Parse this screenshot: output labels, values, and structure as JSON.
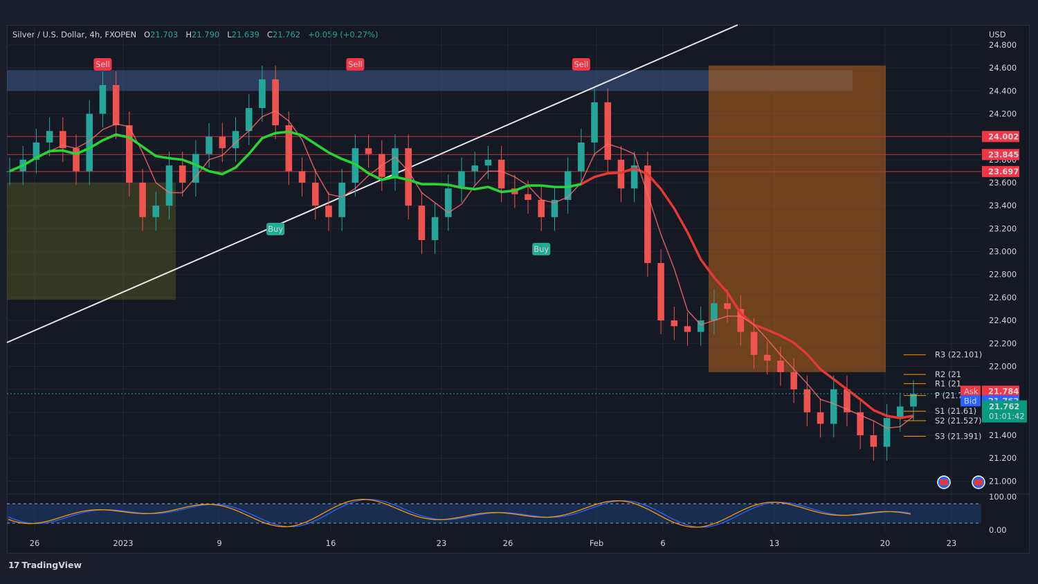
{
  "header": {
    "symbol": "Silver / U.S. Dollar, 4h, FXOPEN",
    "o_label": "O",
    "o": "21.703",
    "h_label": "H",
    "h": "21.790",
    "l_label": "L",
    "l": "21.639",
    "c_label": "C",
    "c": "21.762",
    "change": "+0.059 (+0.27%)"
  },
  "currency": "USD",
  "footer": {
    "brand": "TradingView"
  },
  "colors": {
    "up": "#26a69a",
    "down": "#ef5350",
    "sell_signal": "#f23645",
    "buy_signal": "#22ab94",
    "pivot": "#ff9800",
    "ask": "#f23645",
    "bid": "#2962ff"
  },
  "chart_data": {
    "type": "line",
    "title": "Silver / U.S. Dollar, 4h, FXOPEN",
    "ylim": [
      20.9,
      24.95
    ],
    "y_ticks": [
      24.8,
      24.6,
      24.4,
      24.2,
      24.0,
      23.8,
      23.6,
      23.4,
      23.2,
      23.0,
      22.8,
      22.6,
      22.4,
      22.2,
      22.0,
      21.8,
      21.6,
      21.4,
      21.2,
      21.0
    ],
    "y_tick_labels": [
      "24.800",
      "24.600",
      "24.400",
      "24.200",
      "24.000",
      "23.800",
      "23.600",
      "23.400",
      "23.200",
      "23.000",
      "22.800",
      "22.600",
      "22.400",
      "22.200",
      "22.000",
      "21.800",
      "21.600",
      "21.400",
      "21.200",
      "21.000"
    ],
    "x_labels": [
      "26",
      "2023",
      "9",
      "16",
      "23",
      "26",
      "Feb",
      "6",
      "13",
      "20",
      "23"
    ],
    "series": [
      {
        "values": [
          23.7,
          23.8,
          23.95,
          24.05,
          23.9,
          23.7,
          24.2,
          24.45,
          24.1,
          23.6,
          23.3,
          23.4,
          23.75,
          23.6,
          23.85,
          24.0,
          23.9,
          24.05,
          24.25,
          24.5,
          24.1,
          23.7,
          23.6,
          23.4,
          23.3,
          23.6,
          23.9,
          23.85,
          23.65,
          23.9,
          23.4,
          23.1,
          23.3,
          23.55,
          23.7,
          23.75,
          23.8,
          23.55,
          23.5,
          23.45,
          23.3,
          23.45,
          23.7,
          23.95,
          24.3,
          23.8,
          23.55,
          23.75,
          22.9,
          22.4,
          22.35,
          22.3,
          22.4,
          22.55,
          22.5,
          22.3,
          22.1,
          22.05,
          21.95,
          21.8,
          21.6,
          21.5,
          21.8,
          21.6,
          21.4,
          21.3,
          21.55,
          21.65,
          21.76
        ]
      }
    ],
    "resistance_levels": [
      {
        "label": "24.002",
        "value": 24.002
      },
      {
        "label": "23.845",
        "value": 23.845
      },
      {
        "label": "23.697",
        "value": 23.697
      }
    ],
    "pivots": [
      {
        "label": "R3 (22.101)",
        "value": 22.101
      },
      {
        "label": "R2 (21",
        "value": 21.93
      },
      {
        "label": "R1 (21",
        "value": 21.85
      },
      {
        "label": "P (21.746)",
        "value": 21.746
      },
      {
        "label": "S1 (21.61)",
        "value": 21.61
      },
      {
        "label": "S2 (21.527)",
        "value": 21.527
      },
      {
        "label": "S3 (21.391)",
        "value": 21.391
      }
    ],
    "ask": {
      "label": "Ask",
      "value": "21.784"
    },
    "bid": {
      "label": "Bid",
      "value": "21.762"
    },
    "last_price": {
      "value": "21.762",
      "countdown": "01:01:42"
    },
    "signals": [
      {
        "label": "Sell",
        "x_index": 7
      },
      {
        "label": "Sell",
        "x_index": 26
      },
      {
        "label": "Sell",
        "x_index": 43
      },
      {
        "label": "Buy",
        "x_index": 20
      },
      {
        "label": "Buy",
        "x_index": 40
      }
    ],
    "oscillator": {
      "y_ticks": [
        "100.00",
        "0.00"
      ]
    }
  }
}
